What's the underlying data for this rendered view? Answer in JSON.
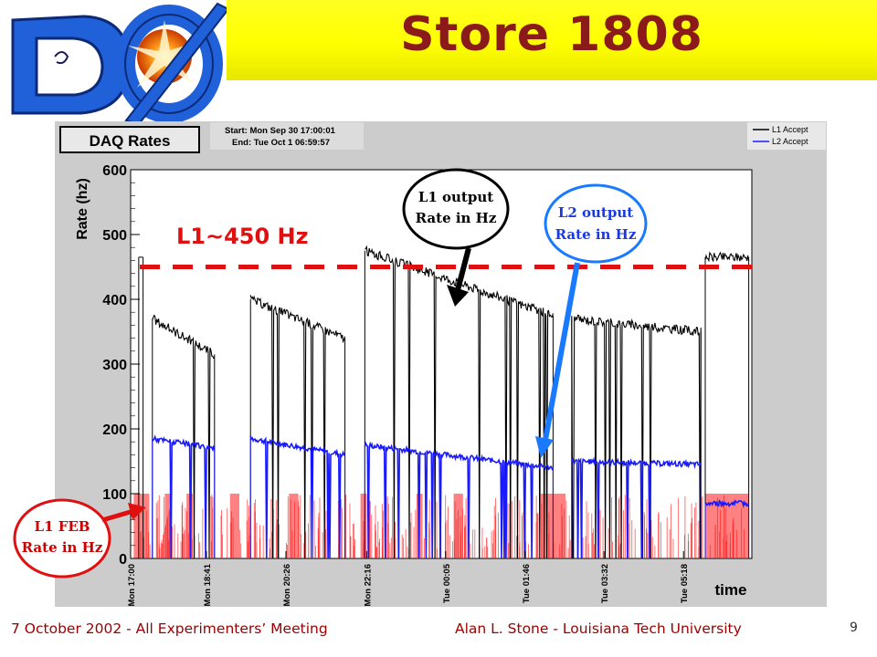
{
  "slide": {
    "title": "Store 1808",
    "logo_alt": "DØ",
    "footer_left": "7 October 2002  - All Experimenters’ Meeting",
    "footer_right": "Alan L. Stone  -  Louisiana Tech University",
    "page_number": "9"
  },
  "plot_header": {
    "title": "DAQ Rates",
    "start": "Start: Mon Sep 30 17:00:01",
    "end": "End: Tue Oct 1 06:59:57",
    "legend": [
      {
        "label": "L1 Accept",
        "color": "#000000"
      },
      {
        "label": "L2 Accept",
        "color": "#1a1aff"
      }
    ]
  },
  "annotations": {
    "l1_threshold": "L1~450 Hz",
    "l1_output": [
      "L1 output",
      "Rate in Hz"
    ],
    "l2_output": [
      "L2 output",
      "Rate in Hz"
    ],
    "l1_feb": [
      "L1 FEB",
      "Rate in Hz"
    ]
  },
  "colors": {
    "l1": "#000000",
    "l2": "#1a1aff",
    "feb": "#ff1a1a",
    "threshold": "#e01010",
    "title": "#8b1a1a",
    "footer": "#9a0000"
  },
  "chart_data": {
    "type": "line",
    "ylabel": "Rate (hz)",
    "xlabel": "time",
    "ylim": [
      0,
      600
    ],
    "yticks": [
      0,
      100,
      200,
      300,
      400,
      500,
      600
    ],
    "x_tick_labels": [
      "Mon 17:00",
      "Mon 18:41",
      "Mon 20:26",
      "Mon 22:16",
      "Tue 00:05",
      "Tue 01:46",
      "Tue 03:32",
      "Tue 05:18"
    ],
    "threshold": 450,
    "series": [
      {
        "name": "L1 Accept",
        "color": "#000000",
        "segments": [
          {
            "x0": 0.035,
            "x1": 0.135,
            "y0": 370,
            "y1": 315
          },
          {
            "x0": 0.193,
            "x1": 0.345,
            "y0": 400,
            "y1": 340
          },
          {
            "x0": 0.377,
            "x1": 0.68,
            "y0": 475,
            "y1": 375
          },
          {
            "x0": 0.71,
            "x1": 0.918,
            "y0": 370,
            "y1": 350
          },
          {
            "x0": 0.925,
            "x1": 0.995,
            "y0": 465,
            "y1": 465
          }
        ]
      },
      {
        "name": "L2 Accept",
        "color": "#1a1aff",
        "segments": [
          {
            "x0": 0.035,
            "x1": 0.135,
            "y0": 185,
            "y1": 170
          },
          {
            "x0": 0.193,
            "x1": 0.345,
            "y0": 185,
            "y1": 160
          },
          {
            "x0": 0.377,
            "x1": 0.68,
            "y0": 175,
            "y1": 140
          },
          {
            "x0": 0.71,
            "x1": 0.918,
            "y0": 150,
            "y1": 145
          },
          {
            "x0": 0.925,
            "x1": 0.995,
            "y0": 85,
            "y1": 85
          }
        ]
      }
    ]
  }
}
